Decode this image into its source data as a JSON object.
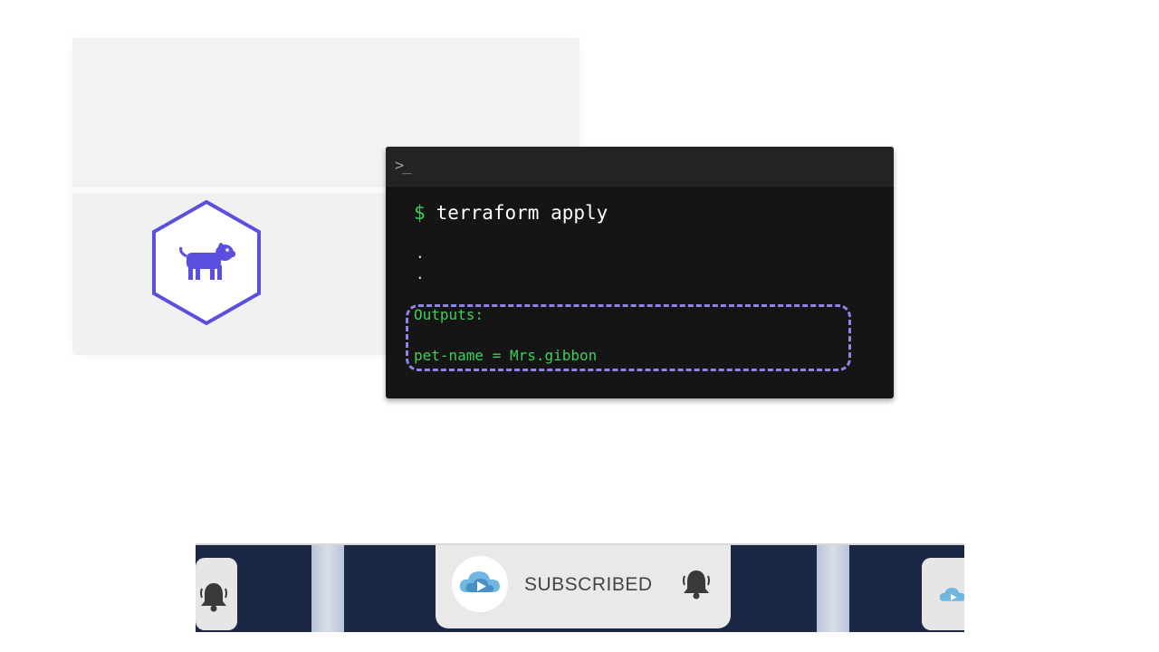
{
  "terminal": {
    "prompt_icon": ">_",
    "prompt_symbol": "$",
    "command": "terraform apply",
    "ellipsis": [
      ".",
      "."
    ],
    "outputs_label": "Outputs:",
    "output_line": "pet-name = Mrs.gibbon"
  },
  "subscribe_banner": {
    "label": "SUBSCRIBED"
  },
  "icons": {
    "resource": "dog-icon",
    "terminal": "terminal-prompt-icon",
    "bell": "bell-icon",
    "channel_logo": "cloud-play-logo"
  },
  "colors": {
    "accent_purple": "#5b4fe0",
    "terminal_green": "#3ecf5a",
    "terminal_bg": "#151515",
    "banner_navy": "#1a2845"
  }
}
